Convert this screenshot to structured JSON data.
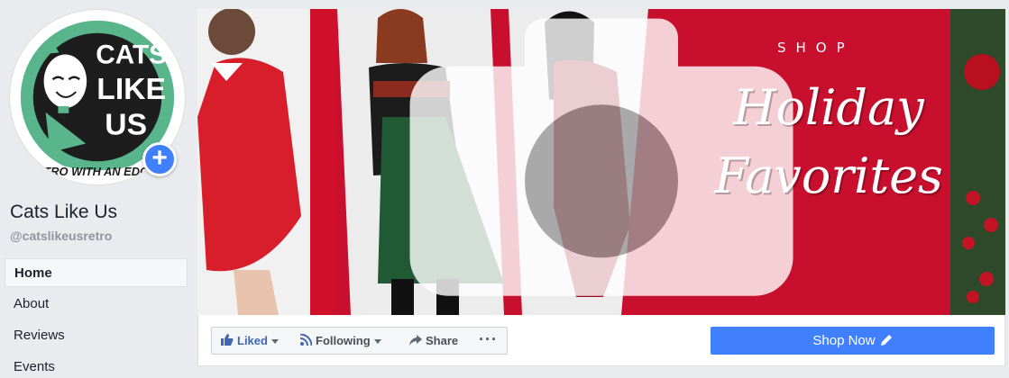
{
  "profile": {
    "logo_lines": [
      "CATS",
      "LIKE",
      "US"
    ],
    "logo_ring_text": "RETRO WITH AN EDGE",
    "add_photo_symbol": "+",
    "name": "Cats Like Us",
    "handle": "@catslikeusretro"
  },
  "nav": {
    "items": [
      {
        "label": "Home",
        "active": true
      },
      {
        "label": "About",
        "active": false
      },
      {
        "label": "Reviews",
        "active": false
      },
      {
        "label": "Events",
        "active": false
      }
    ]
  },
  "cover": {
    "shop_label": "SHOP",
    "headline_line1": "Holiday",
    "headline_line2": "Favorites",
    "camera_icon": "camera-icon"
  },
  "actions": {
    "liked_label": "Liked",
    "following_label": "Following",
    "share_label": "Share",
    "more_label": "···",
    "shop_now_label": "Shop Now"
  },
  "colors": {
    "brand_blue": "#4080ff",
    "fb_blue": "#4267b2",
    "cover_red": "#c8102e",
    "logo_green": "#58b58c"
  }
}
